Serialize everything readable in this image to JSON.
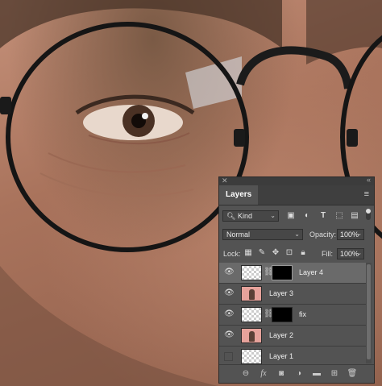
{
  "panel": {
    "tab_title": "Layers",
    "filter_kind": "Kind",
    "blend_mode": "Normal",
    "opacity_label": "Opacity:",
    "opacity_value": "100%",
    "lock_label": "Lock:",
    "fill_label": "Fill:",
    "fill_value": "100%"
  },
  "layers": [
    {
      "name": "Layer 4",
      "visible": true,
      "selected": true,
      "thumb": "transparent",
      "has_mask": true
    },
    {
      "name": "Layer 3",
      "visible": true,
      "selected": false,
      "thumb": "person",
      "has_mask": false
    },
    {
      "name": "fix",
      "visible": true,
      "selected": false,
      "thumb": "transparent",
      "has_mask": true
    },
    {
      "name": "Layer 2",
      "visible": true,
      "selected": false,
      "thumb": "person",
      "has_mask": false
    },
    {
      "name": "Layer 1",
      "visible": false,
      "selected": false,
      "thumb": "transparent",
      "has_mask": false
    }
  ],
  "icons": {
    "close": "✕",
    "collapse": "«",
    "menu": "≡",
    "eye": "👁",
    "link": "🔗",
    "caret": "⌄"
  }
}
